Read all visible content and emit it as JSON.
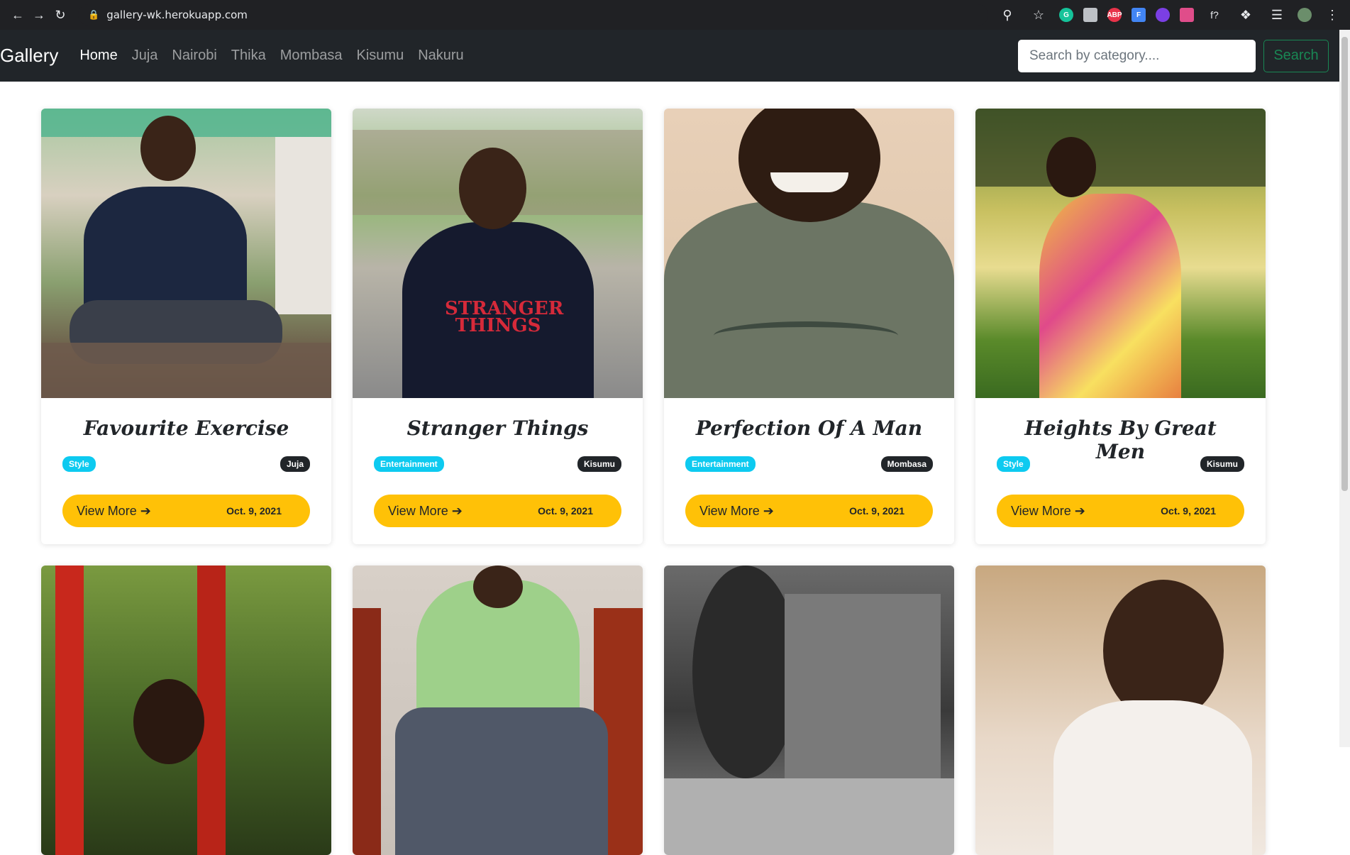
{
  "browser": {
    "url": "gallery-wk.herokuapp.com"
  },
  "navbar": {
    "brand": "Gallery",
    "links": [
      "Home",
      "Juja",
      "Nairobi",
      "Thika",
      "Mombasa",
      "Kisumu",
      "Nakuru"
    ],
    "active": "Home",
    "search_placeholder": "Search by category....",
    "search_label": "Search"
  },
  "cards": [
    {
      "title": "Favourite Exercise",
      "category": "Style",
      "location": "Juja",
      "date": "Oct. 9, 2021",
      "action": "View More"
    },
    {
      "title": "Stranger Things",
      "category": "Entertainment",
      "location": "Kisumu",
      "date": "Oct. 9, 2021",
      "action": "View More"
    },
    {
      "title": "Perfection Of A Man",
      "category": "Entertainment",
      "location": "Mombasa",
      "date": "Oct. 9, 2021",
      "action": "View More"
    },
    {
      "title": "Heights By Great Men",
      "category": "Style",
      "location": "Kisumu",
      "date": "Oct. 9, 2021",
      "action": "View More"
    }
  ],
  "colors": {
    "navbar": "#212529",
    "accent": "#ffc107",
    "badge_category": "#0dcaf0",
    "search_button": "#198754"
  }
}
